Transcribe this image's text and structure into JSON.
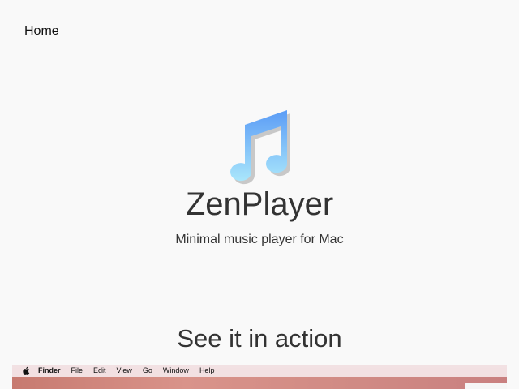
{
  "nav": {
    "home_label": "Home"
  },
  "hero": {
    "logo_icon": "music-note-icon",
    "title": "ZenPlayer",
    "tagline": "Minimal music player for Mac"
  },
  "section": {
    "title": "See it in action"
  },
  "preview": {
    "menubar": {
      "apple_icon": "apple-icon",
      "items": [
        "Finder",
        "File",
        "Edit",
        "View",
        "Go",
        "Window",
        "Help"
      ]
    }
  },
  "colors": {
    "background": "#f9f9f9",
    "logo_gradient_top": "#5b9cf6",
    "logo_gradient_bottom": "#a9e6fb",
    "logo_shadow": "#c8c8c8"
  }
}
